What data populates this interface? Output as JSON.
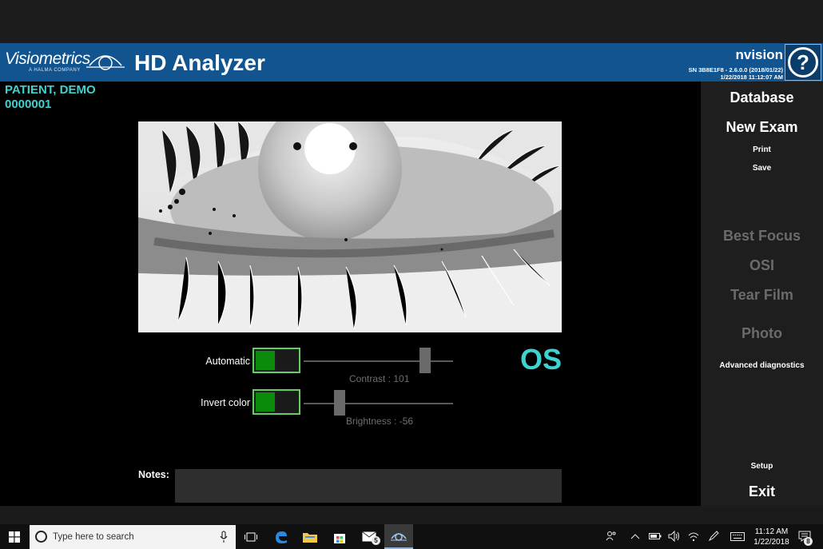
{
  "header": {
    "logo_text": "Visiometrics",
    "logo_subtext": "A HALMA COMPANY",
    "app_title": "HD Analyzer",
    "brand": "nvision",
    "version_line1": "SN 3B8E1F8 - 2.6.0.0 (2018/01/22)",
    "version_line2": "1/22/2018 11:12:07 AM",
    "help_label": "?"
  },
  "patient": {
    "name": "PATIENT, DEMO",
    "id": "0000001"
  },
  "controls": {
    "automatic_label": "Automatic",
    "automatic_on": true,
    "invert_label": "Invert color",
    "invert_on": true,
    "contrast_caption": "Contrast : 101",
    "contrast_value": 101,
    "brightness_caption": "Brightness : -56",
    "brightness_value": -56
  },
  "eye_side": "OS",
  "notes": {
    "label": "Notes:",
    "value": ""
  },
  "sidebar": {
    "database": "Database",
    "new_exam": "New Exam",
    "print": "Print",
    "save": "Save",
    "best_focus": "Best Focus",
    "osi": "OSI",
    "tear_film": "Tear Film",
    "photo": "Photo",
    "advanced": "Advanced diagnostics",
    "setup": "Setup",
    "exit": "Exit"
  },
  "taskbar": {
    "search_placeholder": "Type here to search",
    "mail_badge": "5",
    "time": "11:12 AM",
    "date": "1/22/2018",
    "notification_badge": "8"
  },
  "colors": {
    "header_bg": "#11548f",
    "accent_teal": "#3ed3d0",
    "toggle_green": "#0b8a0b"
  }
}
